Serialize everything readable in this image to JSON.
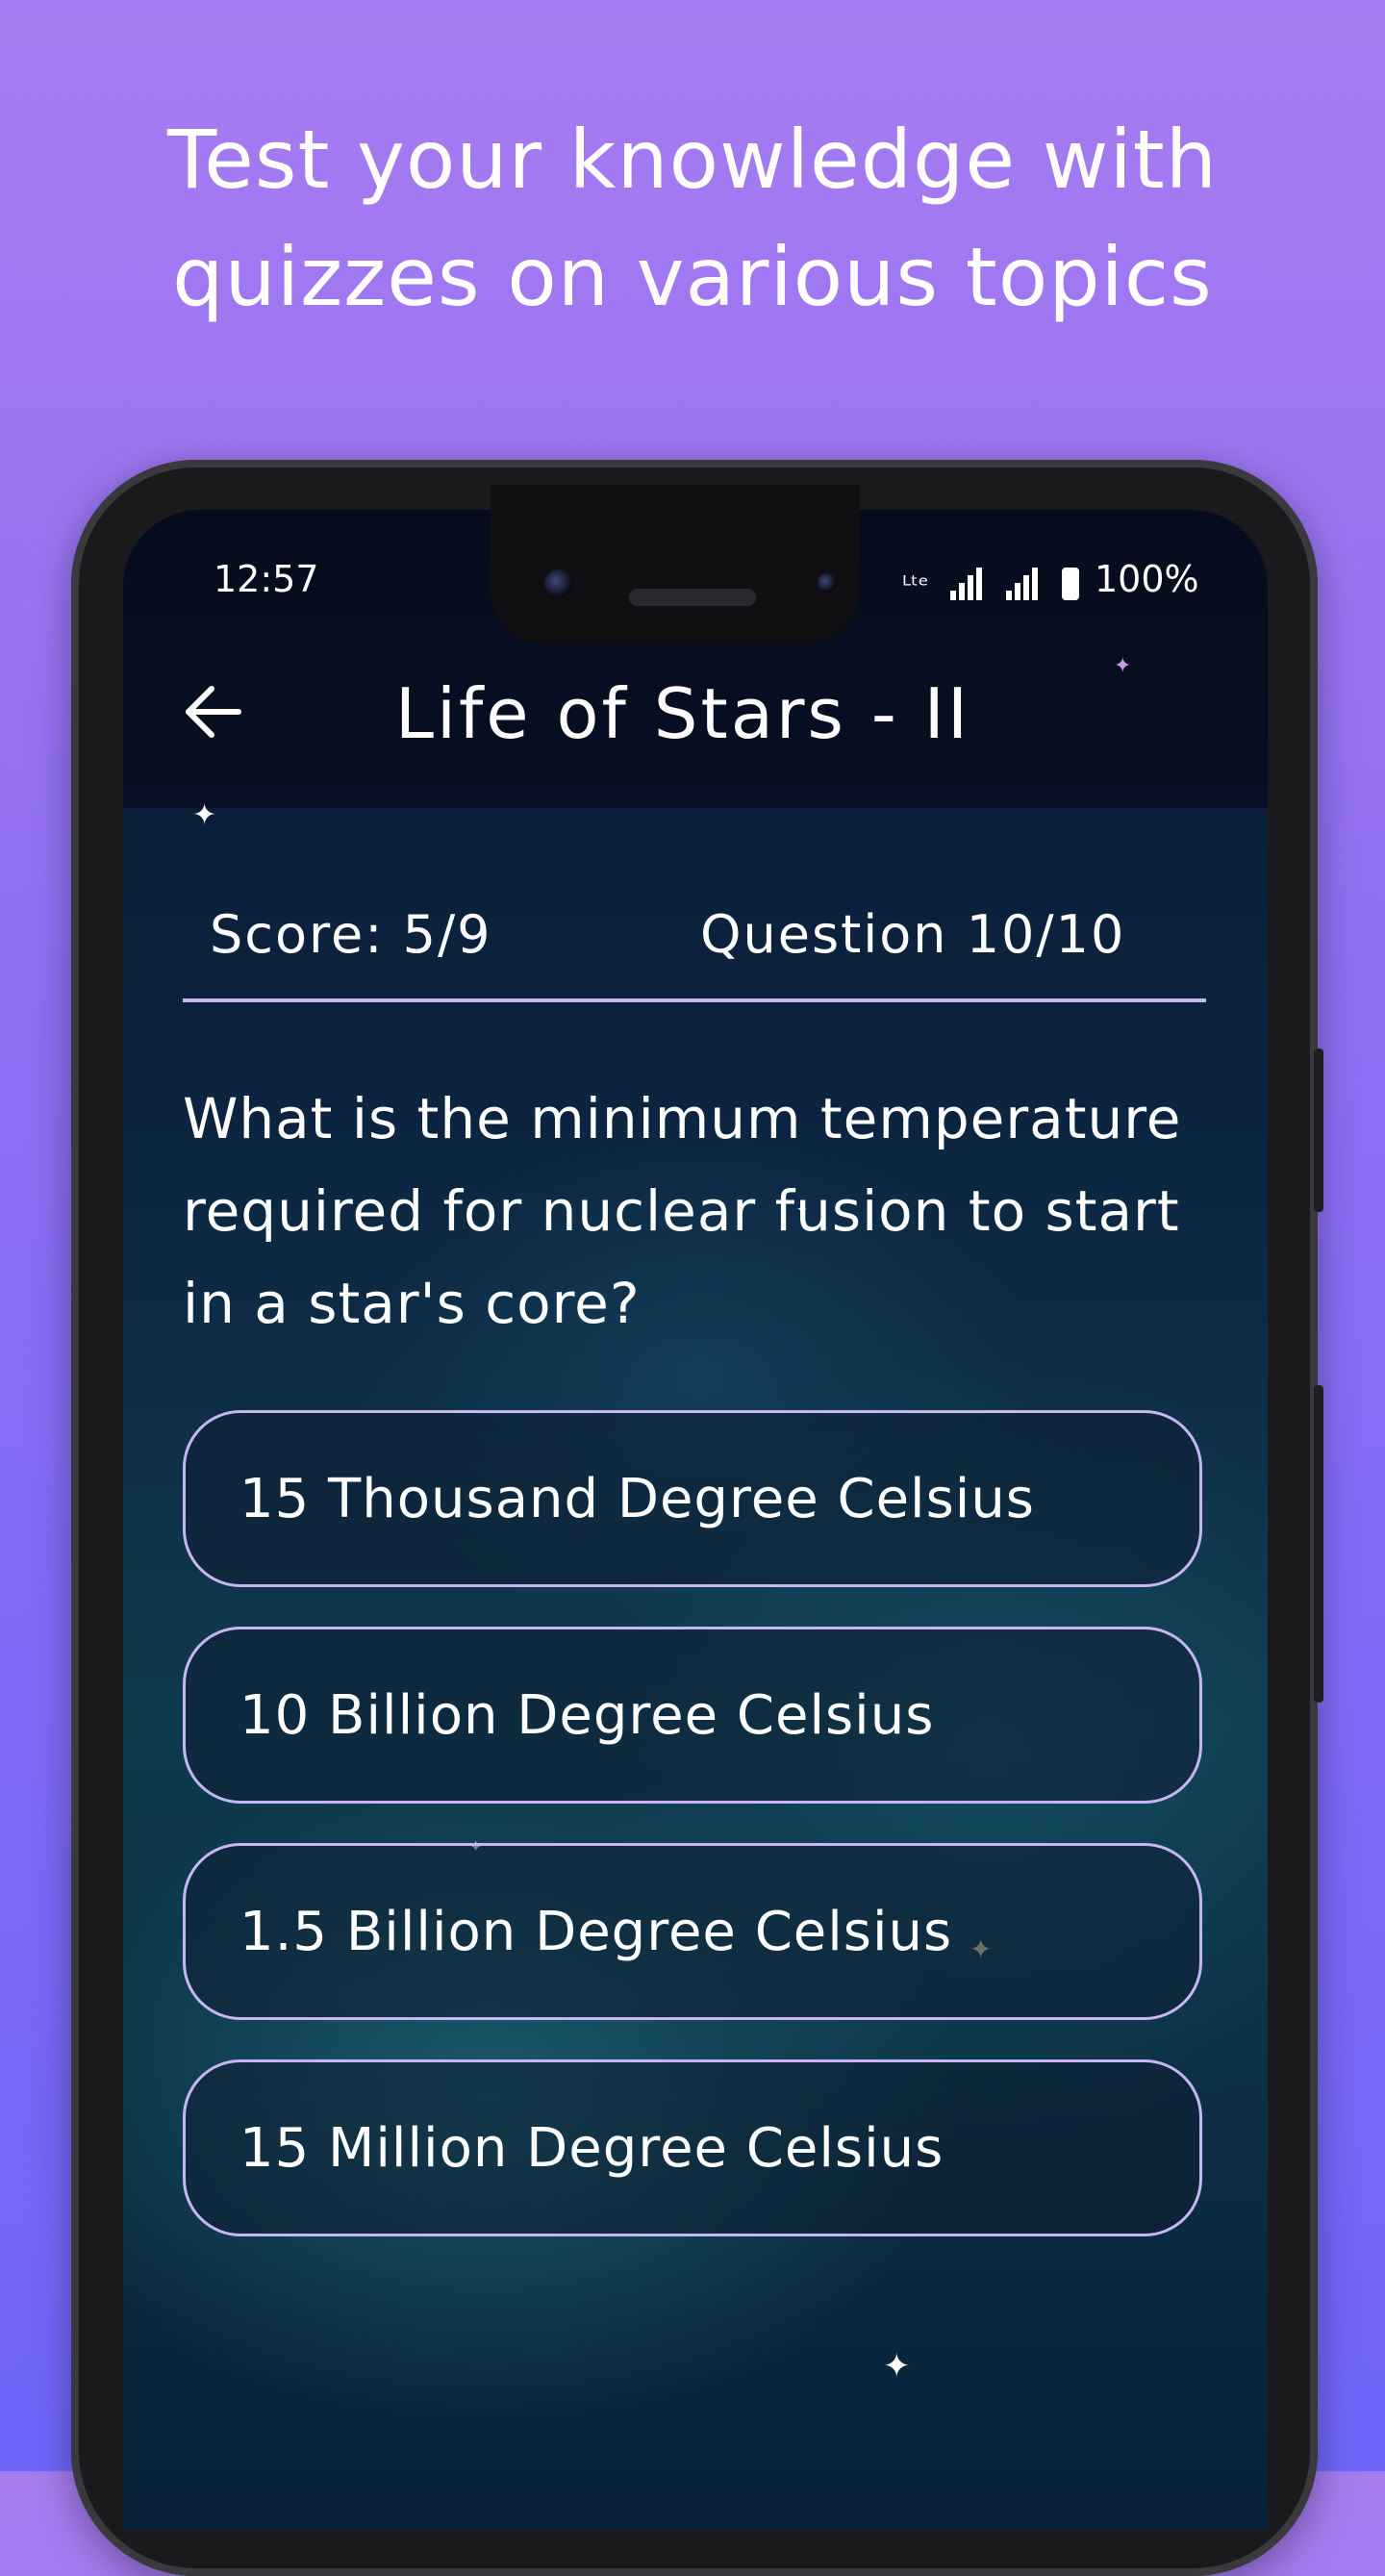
{
  "promo": {
    "line1": "Test your knowledge with",
    "line2": "quizzes on various topics"
  },
  "status_bar": {
    "time": "12:57",
    "battery": "100%"
  },
  "app_bar": {
    "back_icon": "arrow-left-icon",
    "title": "Life of Stars - II"
  },
  "quiz": {
    "score": "Score: 5/9",
    "question_number": "Question 10/10",
    "question": "What is the minimum temperature required for nuclear fusion to start in a star's core?",
    "options": [
      {
        "label": "15 Thousand Degree Celsius"
      },
      {
        "label": "10 Billion Degree Celsius"
      },
      {
        "label": "1.5 Billion Degree Celsius"
      },
      {
        "label": "15 Million Degree Celsius"
      }
    ]
  },
  "colors": {
    "background_top": "#a67cf0",
    "background_bottom": "#6f66fb",
    "option_border": "#c7b6f3",
    "screen_bg": "#0c2440"
  }
}
